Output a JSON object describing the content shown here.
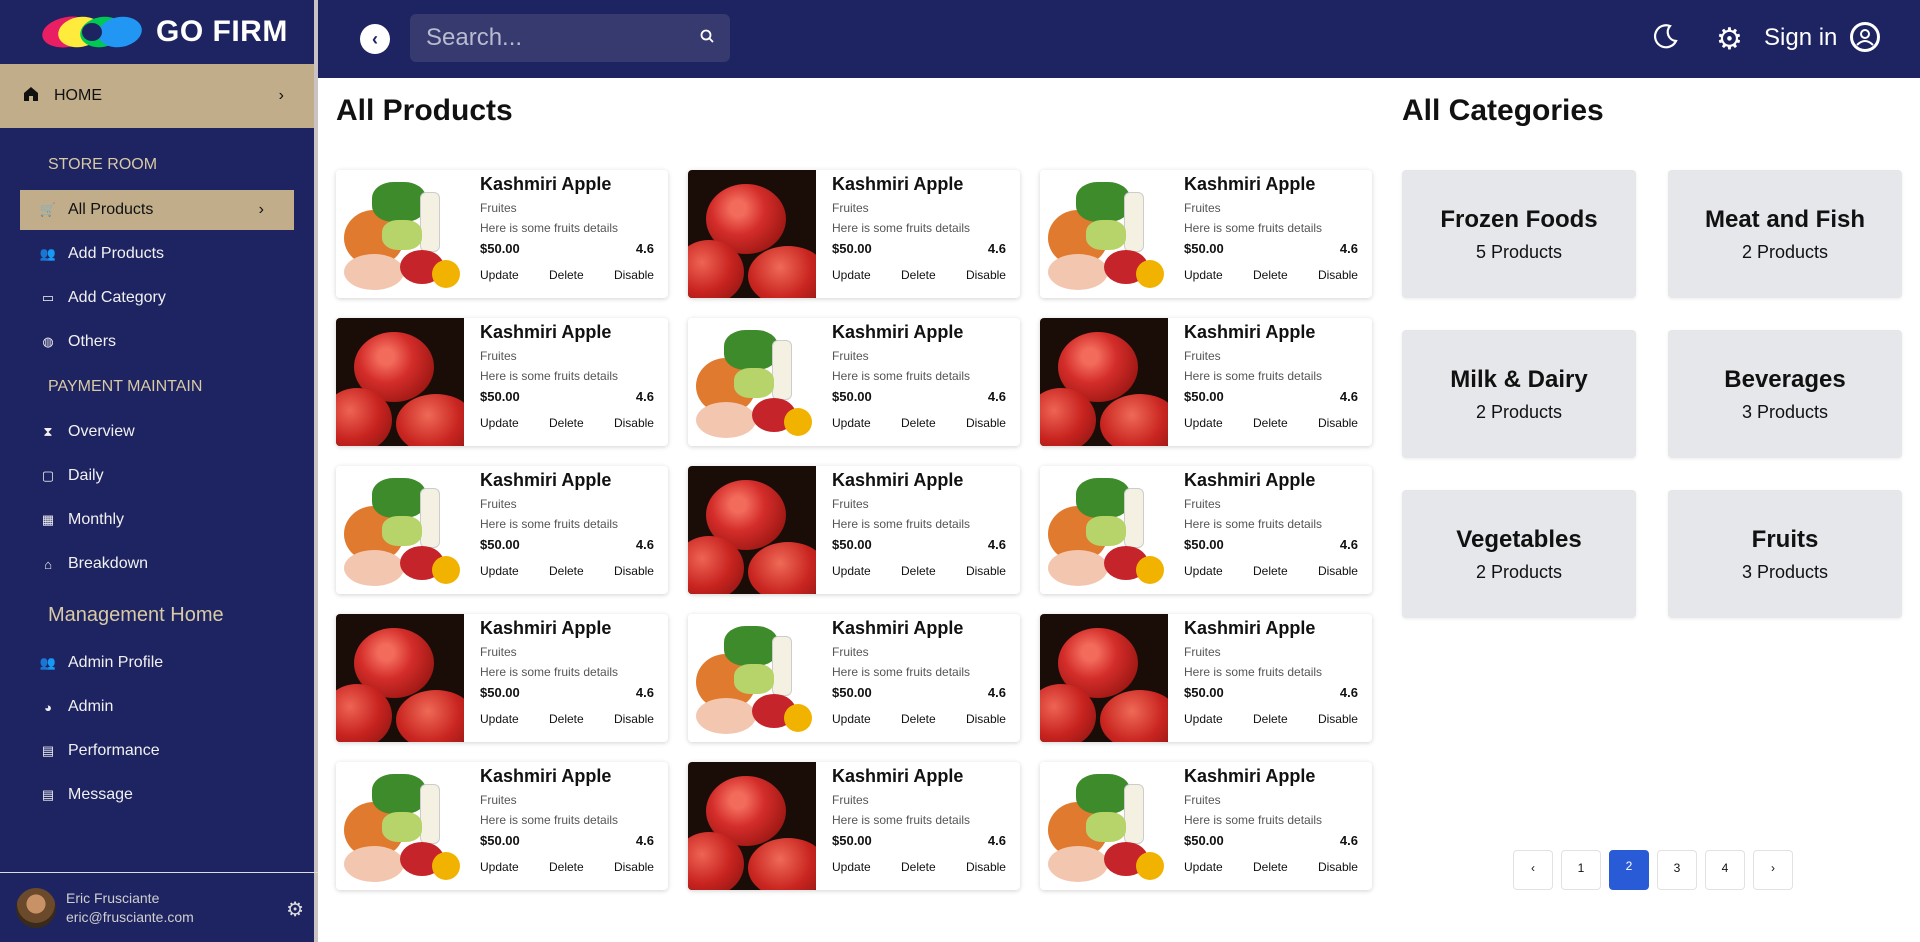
{
  "brand": {
    "title": "GO FIRM"
  },
  "sidebar": {
    "home": "HOME",
    "section_store": "STORE ROOM",
    "store_items": [
      {
        "label": "All Products",
        "icon": "cart-icon"
      },
      {
        "label": "Add Products",
        "icon": "users-icon"
      },
      {
        "label": "Add Category",
        "icon": "tag-icon"
      },
      {
        "label": "Others",
        "icon": "globe-icon"
      }
    ],
    "section_payment": "PAYMENT MAINTAIN",
    "payment_items": [
      {
        "label": "Overview",
        "icon": "hourglass-icon"
      },
      {
        "label": "Daily",
        "icon": "calendar-icon"
      },
      {
        "label": "Monthly",
        "icon": "calendar-grid-icon"
      },
      {
        "label": "Breakdown",
        "icon": "home-icon"
      }
    ],
    "section_management": "Management Home",
    "management_items": [
      {
        "label": "Admin Profile",
        "icon": "users-icon"
      },
      {
        "label": "Admin",
        "icon": "admin-icon"
      },
      {
        "label": "Performance",
        "icon": "chart-icon"
      },
      {
        "label": "Message",
        "icon": "message-icon"
      }
    ],
    "user": {
      "name": "Eric Frusciante",
      "email": "eric@frusciante.com"
    }
  },
  "topbar": {
    "search_placeholder": "Search...",
    "signin": "Sign in"
  },
  "products": {
    "title": "All Products",
    "items": [
      {
        "name": "Kashmiri Apple",
        "category": "Fruites",
        "desc": "Here is some fruits details",
        "price": "$50.00",
        "rating": "4.6",
        "image": "mix"
      },
      {
        "name": "Kashmiri Apple",
        "category": "Fruites",
        "desc": "Here is some fruits details",
        "price": "$50.00",
        "rating": "4.6",
        "image": "apple"
      },
      {
        "name": "Kashmiri Apple",
        "category": "Fruites",
        "desc": "Here is some fruits details",
        "price": "$50.00",
        "rating": "4.6",
        "image": "mix"
      },
      {
        "name": "Kashmiri Apple",
        "category": "Fruites",
        "desc": "Here is some fruits details",
        "price": "$50.00",
        "rating": "4.6",
        "image": "apple"
      },
      {
        "name": "Kashmiri Apple",
        "category": "Fruites",
        "desc": "Here is some fruits details",
        "price": "$50.00",
        "rating": "4.6",
        "image": "mix"
      },
      {
        "name": "Kashmiri Apple",
        "category": "Fruites",
        "desc": "Here is some fruits details",
        "price": "$50.00",
        "rating": "4.6",
        "image": "apple"
      },
      {
        "name": "Kashmiri Apple",
        "category": "Fruites",
        "desc": "Here is some fruits details",
        "price": "$50.00",
        "rating": "4.6",
        "image": "mix"
      },
      {
        "name": "Kashmiri Apple",
        "category": "Fruites",
        "desc": "Here is some fruits details",
        "price": "$50.00",
        "rating": "4.6",
        "image": "apple"
      },
      {
        "name": "Kashmiri Apple",
        "category": "Fruites",
        "desc": "Here is some fruits details",
        "price": "$50.00",
        "rating": "4.6",
        "image": "mix"
      },
      {
        "name": "Kashmiri Apple",
        "category": "Fruites",
        "desc": "Here is some fruits details",
        "price": "$50.00",
        "rating": "4.6",
        "image": "apple"
      },
      {
        "name": "Kashmiri Apple",
        "category": "Fruites",
        "desc": "Here is some fruits details",
        "price": "$50.00",
        "rating": "4.6",
        "image": "mix"
      },
      {
        "name": "Kashmiri Apple",
        "category": "Fruites",
        "desc": "Here is some fruits details",
        "price": "$50.00",
        "rating": "4.6",
        "image": "apple"
      },
      {
        "name": "Kashmiri Apple",
        "category": "Fruites",
        "desc": "Here is some fruits details",
        "price": "$50.00",
        "rating": "4.6",
        "image": "mix"
      },
      {
        "name": "Kashmiri Apple",
        "category": "Fruites",
        "desc": "Here is some fruits details",
        "price": "$50.00",
        "rating": "4.6",
        "image": "apple"
      },
      {
        "name": "Kashmiri Apple",
        "category": "Fruites",
        "desc": "Here is some fruits details",
        "price": "$50.00",
        "rating": "4.6",
        "image": "mix"
      }
    ],
    "actions": {
      "update": "Update",
      "delete": "Delete",
      "disable": "Disable"
    }
  },
  "categories": {
    "title": "All Categories",
    "items": [
      {
        "name": "Frozen Foods",
        "count": "5 Products"
      },
      {
        "name": "Meat and Fish",
        "count": "2 Products"
      },
      {
        "name": "Milk & Dairy",
        "count": "2 Products"
      },
      {
        "name": "Beverages",
        "count": "3 Products"
      },
      {
        "name": "Vegetables",
        "count": "2 Products"
      },
      {
        "name": "Fruits",
        "count": "3 Products"
      }
    ]
  },
  "pagination": {
    "prev": "‹",
    "pages": [
      "1",
      "2",
      "3",
      "4"
    ],
    "current": "2",
    "next": "›"
  },
  "colors": {
    "navy": "#1e2361",
    "gold": "#c1ad8a",
    "accent": "#2a5bd7"
  }
}
